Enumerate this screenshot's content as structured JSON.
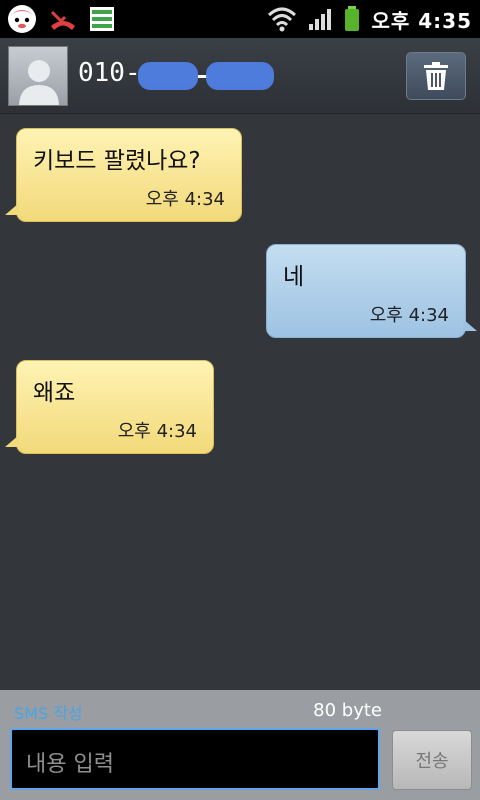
{
  "status_bar": {
    "time": "오후 4:35"
  },
  "header": {
    "contact_prefix": "010-",
    "delete_icon": "trash-icon",
    "avatar_icon": "person-icon"
  },
  "messages": [
    {
      "direction": "incoming",
      "text": "키보드 팔렸나요?",
      "time": "오후 4:34"
    },
    {
      "direction": "outgoing",
      "text": "네",
      "time": "오후 4:34"
    },
    {
      "direction": "incoming",
      "text": "왜죠",
      "time": "오후 4:34"
    }
  ],
  "composer": {
    "sms_label": "SMS 작성",
    "byte_count": "80 byte",
    "placeholder": "내용 입력",
    "send_label": "전송"
  },
  "colors": {
    "background": "#33373b",
    "incoming_bubble": "#f2d97a",
    "outgoing_bubble": "#9dc3e3",
    "accent": "#5fa7e8"
  }
}
